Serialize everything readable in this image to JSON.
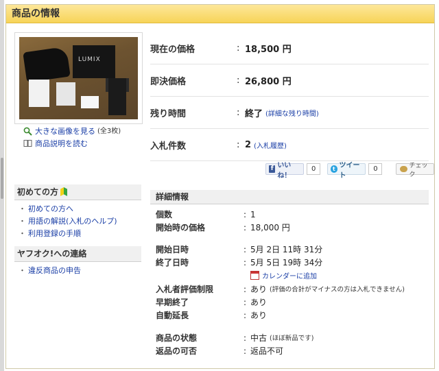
{
  "header": {
    "title": "商品の情報"
  },
  "item_links": {
    "large_image": "大きな画像を見る",
    "large_image_count": "(全3枚)",
    "read_description": "商品説明を読む"
  },
  "photo": {
    "brand": "LUMIX"
  },
  "summary": {
    "current_price_label": "現在の価格",
    "current_price_value": "18,500 円",
    "buyout_label": "即決価格",
    "buyout_value": "26,800 円",
    "time_left_label": "残り時間",
    "time_left_value": "終了",
    "time_left_link": "(詳細な残り時間)",
    "bid_count_label": "入札件数",
    "bid_count_value": "2",
    "bid_count_link": "(入札履歴)",
    "colon": ":"
  },
  "social": {
    "like_label": "いいね！",
    "like_count": "0",
    "tweet_label": "ツイート",
    "tweet_count": "0",
    "check_label": "チェック"
  },
  "beginner": {
    "title": "初めての方",
    "items": [
      "初めての方へ",
      "用語の解説(入札のヘルプ)",
      "利用登録の手順"
    ]
  },
  "contact": {
    "title": "ヤフオク!への連絡",
    "items": [
      "違反商品の申告"
    ]
  },
  "details": {
    "title": "詳細情報",
    "quantity_label": "個数",
    "quantity_value": "1",
    "start_price_label": "開始時の価格",
    "start_price_value": "18,000 円",
    "start_date_label": "開始日時",
    "start_date_value": "5月 2日 11時 31分",
    "end_date_label": "終了日時",
    "end_date_value": "5月 5日 19時 34分",
    "calendar_link": "カレンダーに追加",
    "rating_limit_label": "入札者評価制限",
    "rating_limit_value": "あり",
    "rating_limit_note": "(評価の合計がマイナスの方は入札できません)",
    "early_end_label": "早期終了",
    "early_end_value": "あり",
    "auto_extend_label": "自動延長",
    "auto_extend_value": "あり",
    "condition_label": "商品の状態",
    "condition_value": "中古",
    "condition_note": "(ほぼ新品です)",
    "return_label": "返品の可否",
    "return_value": "返品不可"
  }
}
